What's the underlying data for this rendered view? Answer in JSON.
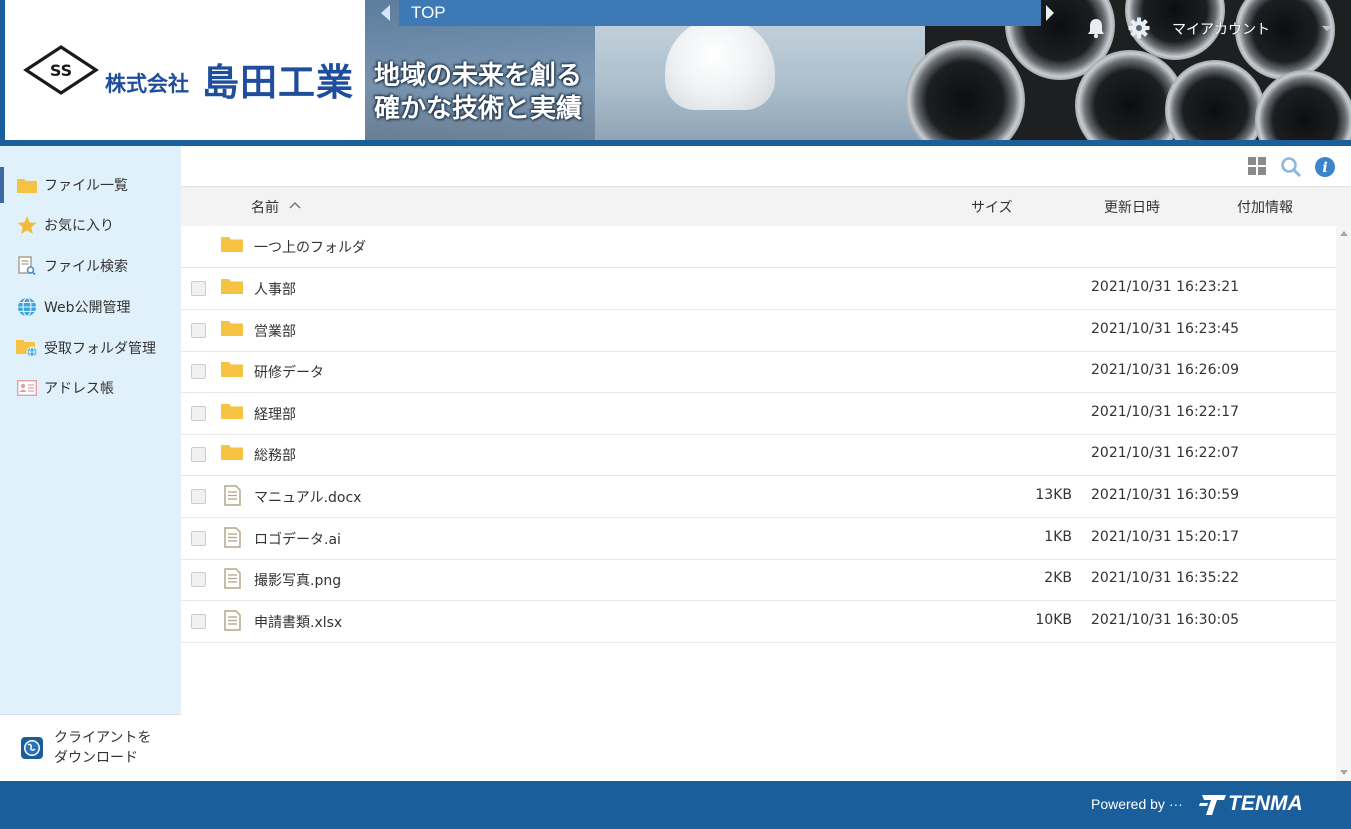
{
  "header": {
    "logo_mark_text": "SS",
    "company_prefix": "株式会社",
    "company_name": "島田工業",
    "banner_line1": "地域の未来を創る",
    "banner_line2": "確かな技術と実績",
    "breadcrumb": "TOP",
    "account_label": "マイアカウント"
  },
  "sidebar": {
    "items": [
      {
        "label": "ファイル一覧",
        "icon": "folder-icon"
      },
      {
        "label": "お気に入り",
        "icon": "star-icon"
      },
      {
        "label": "ファイル検索",
        "icon": "file-search-icon"
      },
      {
        "label": "Web公開管理",
        "icon": "globe-icon"
      },
      {
        "label": "受取フォルダ管理",
        "icon": "folder-globe-icon"
      },
      {
        "label": "アドレス帳",
        "icon": "address-card-icon"
      }
    ],
    "download_line1": "クライアントを",
    "download_line2": "ダウンロード"
  },
  "columns": {
    "name": "名前",
    "size": "サイズ",
    "updated": "更新日時",
    "extra": "付加情報"
  },
  "files": {
    "up_label": "一つ上のフォルダ",
    "rows": [
      {
        "name": "人事部",
        "type": "folder",
        "size": "",
        "date": "2021/10/31 16:23:21"
      },
      {
        "name": "営業部",
        "type": "folder",
        "size": "",
        "date": "2021/10/31 16:23:45"
      },
      {
        "name": "研修データ",
        "type": "folder",
        "size": "",
        "date": "2021/10/31 16:26:09"
      },
      {
        "name": "経理部",
        "type": "folder",
        "size": "",
        "date": "2021/10/31 16:22:17"
      },
      {
        "name": "総務部",
        "type": "folder",
        "size": "",
        "date": "2021/10/31 16:22:07"
      },
      {
        "name": "マニュアル.docx",
        "type": "file",
        "size": "13KB",
        "date": "2021/10/31 16:30:59"
      },
      {
        "name": "ロゴデータ.ai",
        "type": "file",
        "size": "1KB",
        "date": "2021/10/31 15:20:17"
      },
      {
        "name": "撮影写真.png",
        "type": "file",
        "size": "2KB",
        "date": "2021/10/31 16:35:22"
      },
      {
        "name": "申請書類.xlsx",
        "type": "file",
        "size": "10KB",
        "date": "2021/10/31 16:30:05"
      }
    ]
  },
  "footer": {
    "powered_by": "Powered by ···",
    "brand": "TENMA"
  },
  "colors": {
    "brand_blue": "#1b5e9c",
    "sidebar_bg": "#e1f1fb",
    "folder_yellow": "#f5c242"
  }
}
